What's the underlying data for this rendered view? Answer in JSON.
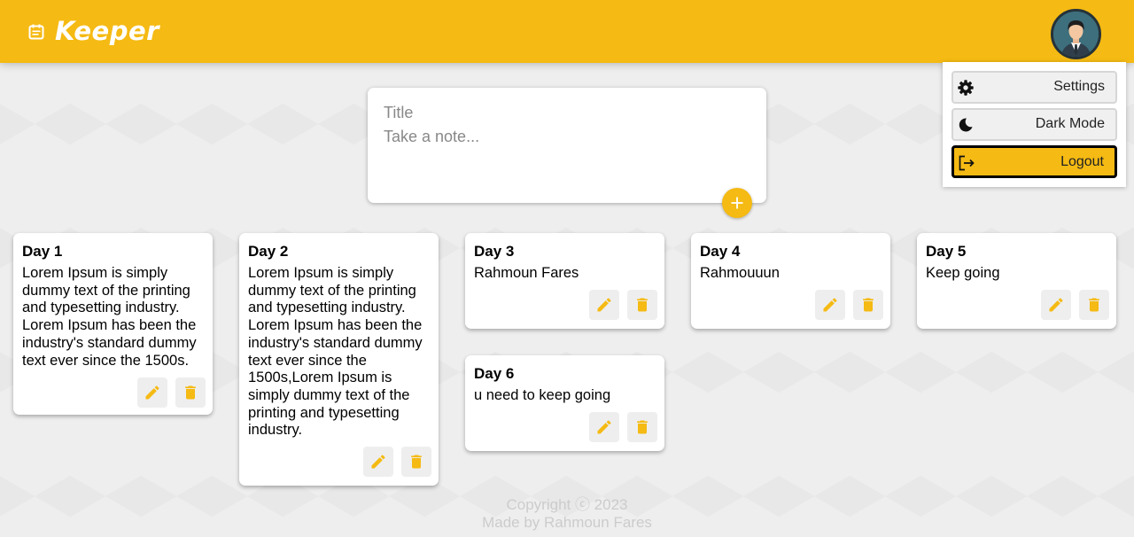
{
  "app": {
    "title": "Keeper"
  },
  "menu": {
    "settings": "Settings",
    "dark_mode": "Dark Mode",
    "logout": "Logout"
  },
  "composer": {
    "title_placeholder": "Title",
    "content_placeholder": "Take a note..."
  },
  "notes": [
    {
      "title": "Day 1",
      "content": "Lorem Ipsum is simply dummy text of the printing and typesetting industry. Lorem Ipsum has been the industry's standard dummy text ever since the 1500s."
    },
    {
      "title": "Day 2",
      "content": "Lorem Ipsum is simply dummy text of the printing and typesetting industry. Lorem Ipsum has been the industry's standard dummy text ever since the 1500s,Lorem Ipsum is simply dummy text of the printing and typesetting industry."
    },
    {
      "title": "Day 3",
      "content": "Rahmoun Fares"
    },
    {
      "title": "Day 4",
      "content": "Rahmouuun"
    },
    {
      "title": "Day 5",
      "content": "Keep going"
    },
    {
      "title": "Day 6",
      "content": "u need to keep going"
    }
  ],
  "footer": {
    "copyright": "Copyright ⓒ 2023",
    "made_by": "Made by Rahmoun Fares"
  },
  "colors": {
    "accent": "#f5ba13",
    "footer_text": "#cccccc"
  },
  "icons": {
    "logo": "note-icon",
    "settings": "gear-icon",
    "dark_mode": "moon-icon",
    "logout": "logout-icon",
    "add": "plus-icon",
    "edit": "pencil-icon",
    "delete": "trash-icon"
  }
}
